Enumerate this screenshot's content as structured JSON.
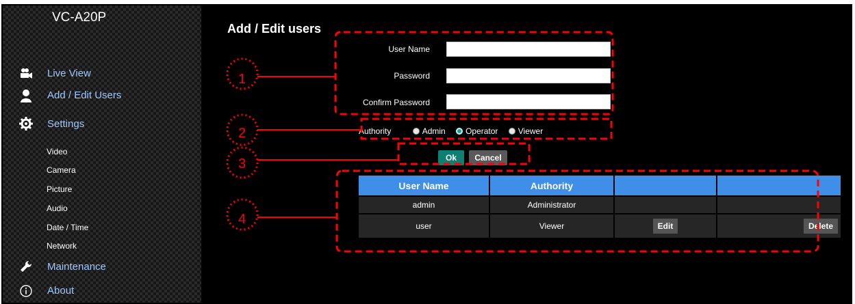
{
  "sidebar": {
    "model": "VC-A20P",
    "main_items": [
      {
        "label": "Live View",
        "icon": "video-camera-icon"
      },
      {
        "label": "Add / Edit Users",
        "icon": "user-icon"
      },
      {
        "label": "Settings",
        "icon": "gear-icon"
      }
    ],
    "sub_items": [
      "Video",
      "Camera",
      "Picture",
      "Audio",
      "Date / Time",
      "Network"
    ],
    "bottom_items": [
      {
        "label": "Maintenance",
        "icon": "wrench-icon"
      },
      {
        "label": "About",
        "icon": "info-icon"
      }
    ]
  },
  "page": {
    "title": "Add / Edit users",
    "fields": {
      "user_name_label": "User Name",
      "password_label": "Password",
      "confirm_password_label": "Confirm Password",
      "user_name_value": "",
      "password_value": "",
      "confirm_password_value": ""
    },
    "authority": {
      "label": "Authority",
      "options": [
        "Admin",
        "Operator",
        "Viewer"
      ],
      "selected": "Operator"
    },
    "buttons": {
      "ok": "Ok",
      "cancel": "Cancel"
    },
    "table": {
      "headers": [
        "User Name",
        "Authority",
        "",
        ""
      ],
      "rows": [
        {
          "user": "admin",
          "authority": "Administrator",
          "edit": "",
          "delete": ""
        },
        {
          "user": "user",
          "authority": "Viewer",
          "edit": "Edit",
          "delete": "Delete"
        }
      ]
    }
  },
  "callouts": [
    "1",
    "2",
    "3",
    "4"
  ],
  "colors": {
    "accent": "#3f8fe8",
    "ok": "#0d7f73",
    "callout": "#ff0000"
  }
}
